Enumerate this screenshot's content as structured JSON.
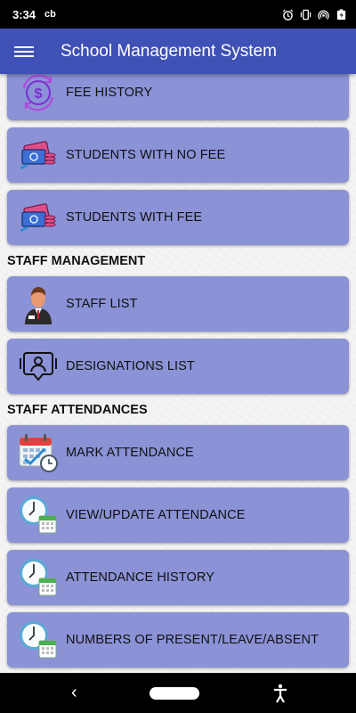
{
  "status_bar": {
    "time": "3:34",
    "carrier": "cb"
  },
  "app_bar": {
    "title": "School Management System"
  },
  "menu": {
    "fee_history": "FEE HISTORY",
    "students_no_fee": "STUDENTS WITH NO FEE",
    "students_with_fee": "STUDENTS WITH FEE",
    "staff_management_header": "STAFF MANAGEMENT",
    "staff_list": "STAFF LIST",
    "designations_list": "DESIGNATIONS LIST",
    "staff_attendances_header": "STAFF ATTENDANCES",
    "mark_attendance": "MARK ATTENDANCE",
    "view_update_attendance": "VIEW/UPDATE ATTENDANCE",
    "attendance_history": "ATTENDANCE HISTORY",
    "numbers_present": "NUMBERS OF PRESENT/LEAVE/ABSENT"
  },
  "colors": {
    "app_bar": "#3f51b5",
    "card": "#8b92d6"
  },
  "icons": {
    "status": [
      "alarm-icon",
      "vibrate-icon",
      "hotspot-icon",
      "battery-icon"
    ],
    "items": [
      "dollar-cycle-icon",
      "money-cards-icon",
      "money-cards-icon",
      "staff-person-icon",
      "designation-chat-icon",
      "calendar-clock-icon",
      "clock-calendar-icon",
      "clock-calendar-icon",
      "clock-calendar-icon"
    ]
  }
}
